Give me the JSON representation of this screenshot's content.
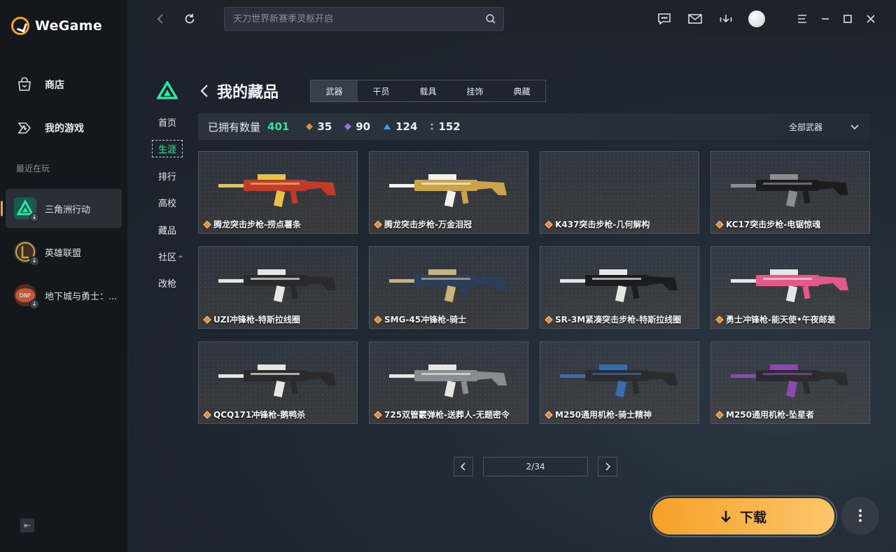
{
  "app": {
    "logo_text": "WeGame"
  },
  "sidebar": {
    "nav": [
      {
        "label": "商店",
        "icon": "store-bag-icon"
      },
      {
        "label": "我的游戏",
        "icon": "gamepad-icon"
      }
    ],
    "recent_label": "最近在玩",
    "games": [
      {
        "label": "三角洲行动",
        "icon": "delta-force-icon",
        "color": "#1a5a52",
        "active": true
      },
      {
        "label": "英雄联盟",
        "icon": "league-of-legends-icon",
        "color": "#3a3024"
      },
      {
        "label": "地下城与勇士：...",
        "icon": "dnf-icon",
        "color": "#5a2a22"
      }
    ]
  },
  "topbar": {
    "search_placeholder": "天刀世界新赛季灵枢开启"
  },
  "subnav": {
    "items": [
      "首页",
      "生涯",
      "排行",
      "高校",
      "藏品",
      "社区",
      "改枪"
    ],
    "active_index": 1
  },
  "page": {
    "title": "我的藏品",
    "tabs": [
      "武器",
      "干员",
      "载具",
      "挂饰",
      "典藏"
    ],
    "active_tab": 0
  },
  "stats": {
    "owned_label": "已拥有数量",
    "owned_total": "401",
    "counts": [
      {
        "value": "35",
        "color": "#e08a3c"
      },
      {
        "value": "90",
        "color": "#a06ee8"
      },
      {
        "value": "124",
        "color": "#4a9ee8"
      },
      {
        "value": "152",
        "color": "#2ee59d"
      }
    ],
    "filter_label": "全部武器"
  },
  "items": [
    {
      "name": "腾龙突击步枪-捞点薯条",
      "palette": [
        "#c23a2a",
        "#e8c24a"
      ]
    },
    {
      "name": "腾龙突击步枪-万金泪冠",
      "palette": [
        "#c9a44a",
        "#f2f2ee"
      ]
    },
    {
      "name": "K437突击步枪-几何解构",
      "palette": [
        "#3a3f46",
        "#3a3f46"
      ]
    },
    {
      "name": "KC17突击步枪-电锯惊魂",
      "palette": [
        "#1c1c1e",
        "#8a8c90"
      ]
    },
    {
      "name": "UZI冲锋枪-特斯拉线圈",
      "palette": [
        "#2a2a2c",
        "#e6e6e2"
      ]
    },
    {
      "name": "SMG-45冲锋枪-骑士",
      "palette": [
        "#2c3e5a",
        "#c9b37a"
      ]
    },
    {
      "name": "SR-3M紧凑突击步枪-特斯拉线圈",
      "palette": [
        "#1c1c1e",
        "#e6e6e2"
      ]
    },
    {
      "name": "勇士冲锋枪-能天使•午夜邮差",
      "palette": [
        "#e25a8a",
        "#e6e6e2"
      ]
    },
    {
      "name": "QCQ171冲锋枪-鹅鸭杀",
      "palette": [
        "#2a2a2c",
        "#e6e6e2"
      ]
    },
    {
      "name": "725双管霰弹枪-送葬人-无题密令",
      "palette": [
        "#8a8c90",
        "#e6e6e2"
      ]
    },
    {
      "name": "M250通用机枪-骑士精神",
      "palette": [
        "#2a2c30",
        "#3a6ab0"
      ]
    },
    {
      "name": "M250通用机枪-坠星者",
      "palette": [
        "#2a2c30",
        "#8a4ab0"
      ]
    }
  ],
  "pager": {
    "text": "2/34"
  },
  "download": {
    "label": "下载"
  }
}
